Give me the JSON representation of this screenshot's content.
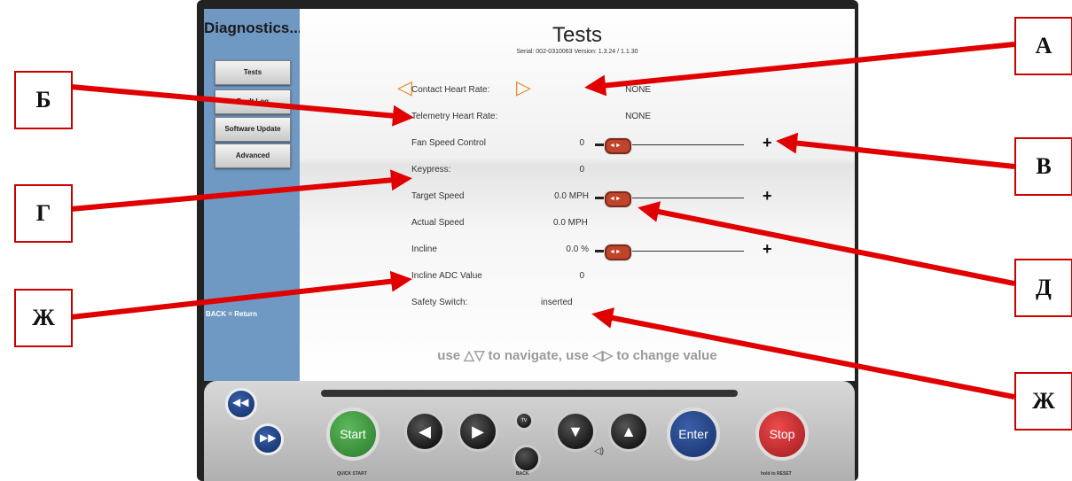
{
  "sidebar": {
    "title": "Diagnostics...",
    "items": [
      {
        "label": "Tests"
      },
      {
        "label": "Fault Log"
      },
      {
        "label": "Software Update"
      },
      {
        "label": "Advanced"
      }
    ],
    "back_hint": "BACK = Return"
  },
  "main": {
    "title": "Tests",
    "serial_info": "Serial: 002-0310063  Version: 1.3.24 / 1.1.30",
    "rows": [
      {
        "label": "Contact Heart Rate:",
        "value": "NONE"
      },
      {
        "label": "Telemetry Heart Rate:",
        "value": "NONE"
      },
      {
        "label": "Fan Speed Control",
        "value": "0",
        "slider_level": 0
      },
      {
        "label": "Keypress:",
        "value": "0"
      },
      {
        "label": "Target Speed",
        "value": "0.0 MPH",
        "slider_level": 0
      },
      {
        "label": "Actual Speed",
        "value": "0.0 MPH"
      },
      {
        "label": "Incline",
        "value": "0.0 %",
        "slider_level": 0
      },
      {
        "label": "Incline ADC Value",
        "value": "0"
      },
      {
        "label": "Safety Switch:",
        "value": "inserted"
      }
    ],
    "nav_hint": "use △▽ to navigate, use ◁▷ to change value"
  },
  "console": {
    "start_label": "Start",
    "start_sub": "QUICK START",
    "enter_label": "Enter",
    "stop_label": "Stop",
    "stop_sub": "hold to RESET",
    "back_label": "BACK",
    "tv_label": "TV"
  },
  "callouts": [
    "А",
    "Б",
    "В",
    "Г",
    "Д",
    "Ж",
    "Ж"
  ],
  "colors": {
    "sidebar": "#6f98c3",
    "arrow": "#e00000",
    "start": "#3c9a3c",
    "enter": "#1e3f7a",
    "stop": "#c8242a",
    "slider_thumb": "#c0442a"
  }
}
